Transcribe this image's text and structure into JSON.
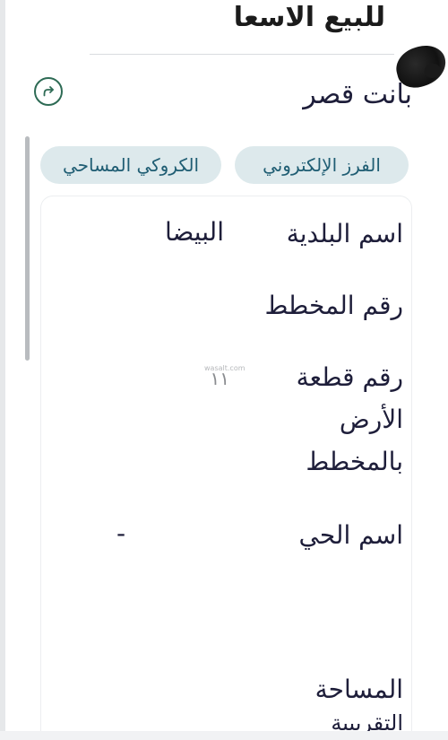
{
  "header": {
    "title": "للبيع الاسعا"
  },
  "owner": {
    "name": "بانت قصر"
  },
  "share": {
    "icon": "share-icon",
    "color": "#2e6b55"
  },
  "tabs": [
    {
      "label": "الفرز الإلكتروني"
    },
    {
      "label": "الكروكي المساحي"
    }
  ],
  "details": {
    "municipality_label": "اسم البلدية",
    "municipality_value": "البيضا",
    "plan_number_label": "رقم المخطط",
    "plot_number_label_line1": "رقم قطعة",
    "plot_number_label_line2": "الأرض",
    "plot_number_label_line3": "بالمخطط",
    "plot_number_value": "١١",
    "neighborhood_label": "اسم الحي",
    "neighborhood_value": "-",
    "area_label": "المساحة",
    "area_value": "التقريبية"
  },
  "watermark": "wasalt.com",
  "colors": {
    "tab_background": "#dde9ec",
    "tab_text": "#1f5d73",
    "text": "#1e1e3a"
  }
}
